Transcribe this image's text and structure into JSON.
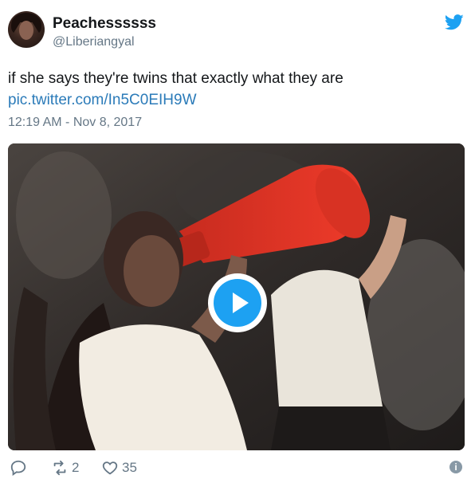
{
  "author": {
    "name": "Peachessssss",
    "handle": "@Liberiangyal",
    "avatar_icon": "profile-photo"
  },
  "tweet": {
    "text": "if she says they're twins that exactly what they are",
    "link": "pic.twitter.com/In5C0EIH9W",
    "timestamp": "12:19 AM - Nov 8, 2017"
  },
  "media": {
    "type": "gif",
    "play_icon": "play-icon"
  },
  "actions": {
    "reply_icon": "reply-icon",
    "retweet_icon": "retweet-icon",
    "retweet_count": "2",
    "like_icon": "heart-icon",
    "like_count": "35",
    "info_icon": "info-icon",
    "info_glyph": "i"
  },
  "colors": {
    "twitter_blue": "#1da1f2",
    "link": "#2b7bb9",
    "muted": "#657786"
  }
}
